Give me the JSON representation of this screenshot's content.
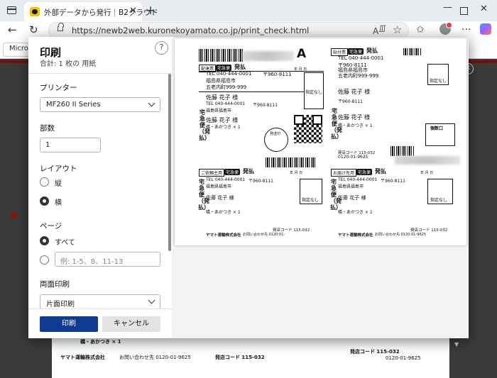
{
  "browser": {
    "tab_title": "外部データから発行｜B2クラウド",
    "tab_close": "✕",
    "new_tab": "+",
    "url": "https://newb2web.kuronekoyamato.co.jp/print_check.html",
    "favorites_item": "Micros"
  },
  "dialog": {
    "title": "印刷",
    "subtitle": "合計: 1 枚の 用紙",
    "help": "?",
    "printer_label": "プリンター",
    "printer_value": "MF260 II Series",
    "copies_label": "部数",
    "copies_value": "1",
    "layout_label": "レイアウト",
    "layout_portrait": "縦",
    "layout_landscape": "横",
    "layout_selected": "横",
    "pages_label": "ページ",
    "pages_all": "すべて",
    "pages_selected": "すべて",
    "pages_placeholder": "例: 1-5、8、11-13",
    "duplex_label": "両面印刷",
    "duplex_value": "片面印刷",
    "print_button": "印刷",
    "cancel_button": "キャンセル"
  },
  "preview": {
    "labels": [
      {
        "type_tag": "配達票",
        "prepaid_tag": "宅急便",
        "payment": "発払",
        "tel": "TEL 040-444-0001",
        "zip": "〒960-8111",
        "addr1": "福島県福島市",
        "addr2": "五老内町999-999",
        "name": "佐藤 花子 様",
        "name_small": "佐藤 花子 様",
        "item": "橋・あかつき × 1",
        "sort_code": "A",
        "specified": "指定なし",
        "date_cols": "年  月  日",
        "tel_small": "TEL 040-444-0001",
        "zip_small": "〒960-8111",
        "addr_small": "福島県福島市",
        "vertical": "宅急便（発払）",
        "stamp": "発送印"
      },
      {
        "type_tag": "貼付票",
        "prepaid_tag": "宅急便",
        "payment": "発払",
        "tel": "TEL 040-444-0001",
        "zip": "〒960-8111",
        "addr1": "福島県福島市",
        "addr2": "五老内町999-999",
        "name": "佐藤 花子 様",
        "name_small": "佐藤 花子 様",
        "item": "橋・あかつき × 1",
        "specified": "指定なし",
        "count_label": "個数口",
        "office_code": "発店コード 115-032",
        "office_phone": "0120-01-9625",
        "date_cols": "年  月  日",
        "zip_small": "〒960-8111",
        "vertical": "宅急便（発払）"
      },
      {
        "type_tag": "ご依頼主用",
        "prepaid_tag": "宅急便",
        "payment": "発払",
        "tel": "TEL 040-444-0001",
        "zip": "〒960-8111",
        "addr1": "福島県福島市",
        "name": "佐藤 花子 様",
        "item": "橋・あかつき × 1",
        "specified": "指定なし",
        "company": "ヤマト運輸株式会社",
        "inquiry": "お問い合わせ先 0120-01-",
        "office_code": "発店コード 115-032",
        "date_cols": "年  月  日",
        "vertical": "宅急便（発払）"
      },
      {
        "type_tag": "お届け先用",
        "prepaid_tag": "宅急便",
        "payment": "発払",
        "tel": "TEL 040-444-0001",
        "zip": "〒960-8111",
        "addr1": "福島県福島市",
        "name": "佐藤 花子 様",
        "item": "橋・あかつき × 1",
        "specified": "指定なし",
        "company": "ヤマト運輸株式会社",
        "inquiry": "お問い合わせ先 0120-01-9625",
        "office_code": "発店コード 115-032",
        "date_cols": "年  月  日",
        "vertical": "宅急便（発払）"
      }
    ]
  },
  "background_page": {
    "item_line": "橋・あかつき × 1",
    "company": "ヤマト運輸株式会社",
    "inquiry": "お問い合わせ先 0120-01-9625",
    "office_code": "発店コード 115-032",
    "office_code2": "発店コード 115-032",
    "phone_tail": "0120-01-9625"
  },
  "colors": {
    "print_button": "#0f3a8f",
    "page_background": "#3b3b3b",
    "accent_strip": "#7b0d0d"
  }
}
